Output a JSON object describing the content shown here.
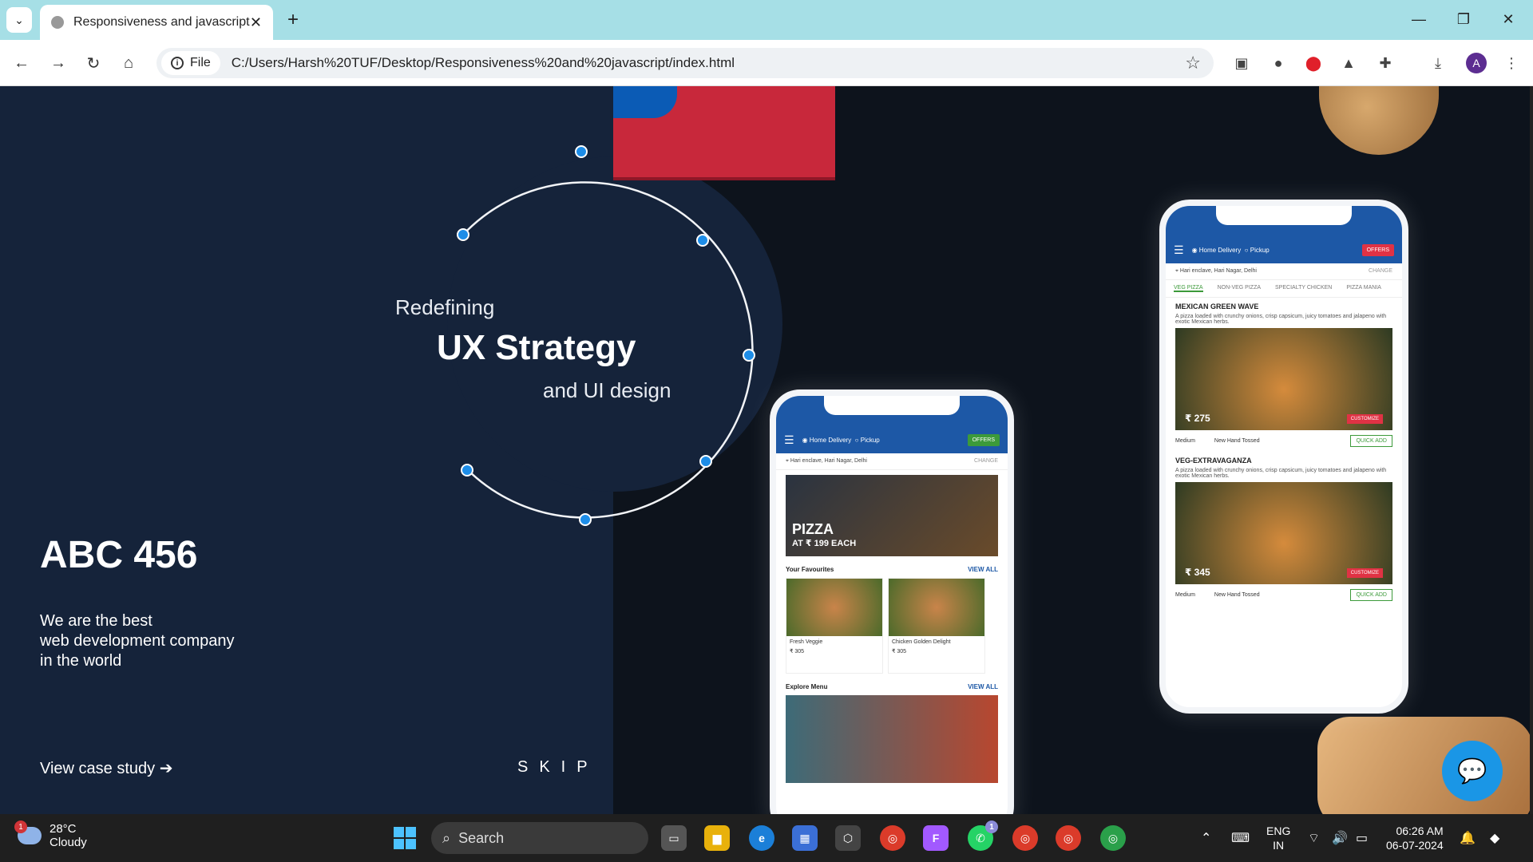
{
  "browser": {
    "tab_title": "Responsiveness and javascript",
    "new_tab_label": "+",
    "address_chip": "File",
    "url": "C:/Users/Harsh%20TUF/Desktop/Responsiveness%20and%20javascript/index.html",
    "profile_initial": "A"
  },
  "hero": {
    "line1": "Redefining",
    "line2": "UX Strategy",
    "line3": "and UI design",
    "brand": "ABC 456",
    "tagline": [
      "We are the best",
      "web development company",
      "in the world"
    ],
    "cta": "View case study",
    "skip": "SKIP"
  },
  "phone_left": {
    "delivery": "Home Delivery",
    "pickup": "Pickup",
    "offers": "OFFERS",
    "location": "Hari enclave, Hari Nagar, Delhi",
    "change": "CHANGE",
    "banner_text": "PIZZA",
    "banner_sub": "AT ₹ 199 EACH",
    "favourites": "Your Favourites",
    "view_all": "VIEW ALL",
    "cards": [
      {
        "name": "Fresh Veggie",
        "price": "₹ 305"
      },
      {
        "name": "Chicken Golden Delight",
        "price": "₹ 305"
      }
    ],
    "explore": "Explore Menu",
    "explore_view_all": "VIEW ALL"
  },
  "phone_right": {
    "delivery": "Home Delivery",
    "pickup": "Pickup",
    "offers": "OFFERS",
    "location": "Hari enclave, Hari Nagar, Delhi",
    "change": "CHANGE",
    "tabs": [
      "VEG PIZZA",
      "NON-VEG PIZZA",
      "SPECIALTY CHICKEN",
      "PIZZA MANIA"
    ],
    "items": [
      {
        "name": "MEXICAN GREEN WAVE",
        "desc": "A pizza loaded with crunchy onions, crisp capsicum, juicy tomatoes and jalapeno with exotic Mexican herbs.",
        "price": "₹ 275",
        "size": "Medium",
        "crust": "New Hand Tossed",
        "customize": "CUSTOMIZE",
        "quick_add": "QUICK ADD"
      },
      {
        "name": "VEG-EXTRAVAGANZA",
        "desc": "A pizza loaded with crunchy onions, crisp capsicum, juicy tomatoes and jalapeno with exotic Mexican herbs.",
        "price": "₹ 345",
        "size": "Medium",
        "crust": "New Hand Tossed",
        "customize": "CUSTOMIZE",
        "quick_add": "QUICK ADD"
      }
    ]
  },
  "taskbar": {
    "temp": "28°C",
    "condition": "Cloudy",
    "weather_badge": "1",
    "search": "Search",
    "whatsapp_badge": "1",
    "lang1": "ENG",
    "lang2": "IN",
    "time": "06:26 AM",
    "date": "06-07-2024"
  }
}
